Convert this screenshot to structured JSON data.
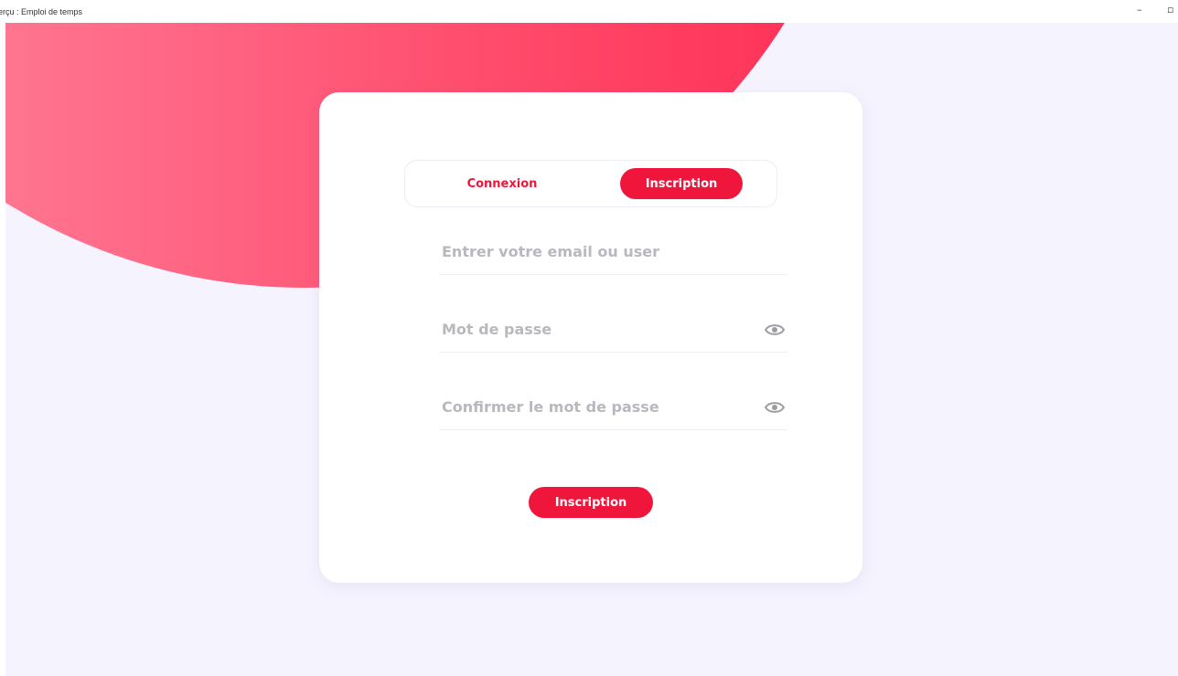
{
  "window": {
    "title": "erçu : Emploi de temps",
    "minimize_glyph": "–",
    "restore_glyph": "▫"
  },
  "auth": {
    "tabs": [
      {
        "label": "Connexion",
        "active": false
      },
      {
        "label": "Inscription",
        "active": true
      }
    ],
    "fields": {
      "email_placeholder": "Entrer votre email ou user",
      "password_placeholder": "Mot de passe",
      "confirm_placeholder": "Confirmer le mot de passe"
    },
    "submit_label": "Inscription"
  },
  "icons": {
    "password_toggle": "eye-icon",
    "confirm_toggle": "eye-icon"
  },
  "colors": {
    "accent": "#f0153a",
    "background": "#f5f3fe",
    "blob_start": "#ff8a9f",
    "blob_end": "#ff2d55",
    "placeholder": "#b8b8be"
  }
}
